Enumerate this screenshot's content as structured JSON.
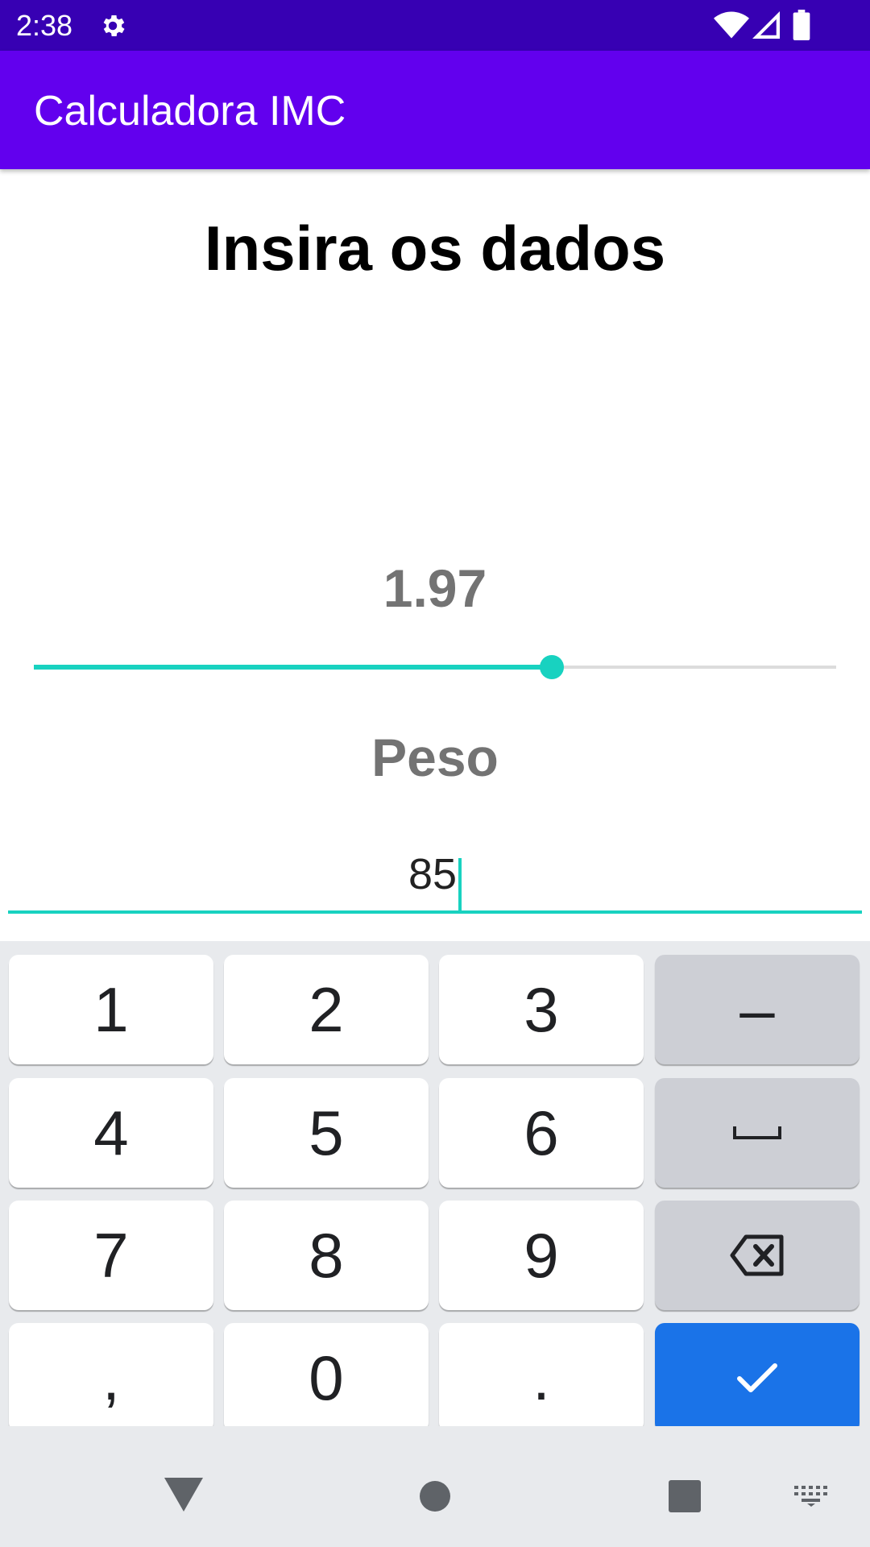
{
  "status_bar": {
    "time": "2:38",
    "icons": [
      "gear-icon",
      "wifi-icon",
      "signal-icon",
      "battery-icon"
    ]
  },
  "app_bar": {
    "title": "Calculadora IMC"
  },
  "main": {
    "heading": "Insira os dados",
    "height": {
      "value_label": "1.97",
      "slider_fraction": 0.646
    },
    "weight": {
      "label": "Peso",
      "value": "85"
    }
  },
  "keyboard": {
    "keys": {
      "k1": "1",
      "k2": "2",
      "k3": "3",
      "minus": "–",
      "k4": "4",
      "k5": "5",
      "k6": "6",
      "k7": "7",
      "k8": "8",
      "k9": "9",
      "comma": ",",
      "k0": "0",
      "period": "."
    },
    "icons": [
      "space-icon",
      "backspace-icon",
      "check-icon"
    ]
  },
  "nav_bar": {
    "icons": [
      "back-icon",
      "home-icon",
      "recents-icon",
      "keyboard-icon"
    ]
  },
  "colors": {
    "status_bar": "#3700b3",
    "app_bar": "#6200ee",
    "accent": "#18d2c0",
    "done_key": "#1a73e8"
  }
}
